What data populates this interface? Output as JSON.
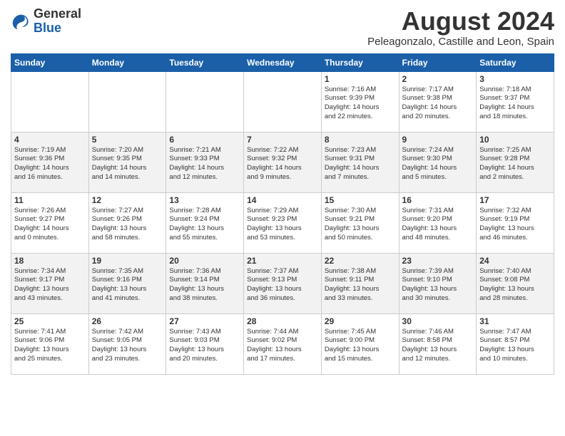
{
  "header": {
    "logo_general": "General",
    "logo_blue": "Blue",
    "month_title": "August 2024",
    "subtitle": "Peleagonzalo, Castille and Leon, Spain"
  },
  "days_of_week": [
    "Sunday",
    "Monday",
    "Tuesday",
    "Wednesday",
    "Thursday",
    "Friday",
    "Saturday"
  ],
  "weeks": [
    [
      {
        "day": "",
        "info": ""
      },
      {
        "day": "",
        "info": ""
      },
      {
        "day": "",
        "info": ""
      },
      {
        "day": "",
        "info": ""
      },
      {
        "day": "1",
        "info": "Sunrise: 7:16 AM\nSunset: 9:39 PM\nDaylight: 14 hours\nand 22 minutes."
      },
      {
        "day": "2",
        "info": "Sunrise: 7:17 AM\nSunset: 9:38 PM\nDaylight: 14 hours\nand 20 minutes."
      },
      {
        "day": "3",
        "info": "Sunrise: 7:18 AM\nSunset: 9:37 PM\nDaylight: 14 hours\nand 18 minutes."
      }
    ],
    [
      {
        "day": "4",
        "info": "Sunrise: 7:19 AM\nSunset: 9:36 PM\nDaylight: 14 hours\nand 16 minutes."
      },
      {
        "day": "5",
        "info": "Sunrise: 7:20 AM\nSunset: 9:35 PM\nDaylight: 14 hours\nand 14 minutes."
      },
      {
        "day": "6",
        "info": "Sunrise: 7:21 AM\nSunset: 9:33 PM\nDaylight: 14 hours\nand 12 minutes."
      },
      {
        "day": "7",
        "info": "Sunrise: 7:22 AM\nSunset: 9:32 PM\nDaylight: 14 hours\nand 9 minutes."
      },
      {
        "day": "8",
        "info": "Sunrise: 7:23 AM\nSunset: 9:31 PM\nDaylight: 14 hours\nand 7 minutes."
      },
      {
        "day": "9",
        "info": "Sunrise: 7:24 AM\nSunset: 9:30 PM\nDaylight: 14 hours\nand 5 minutes."
      },
      {
        "day": "10",
        "info": "Sunrise: 7:25 AM\nSunset: 9:28 PM\nDaylight: 14 hours\nand 2 minutes."
      }
    ],
    [
      {
        "day": "11",
        "info": "Sunrise: 7:26 AM\nSunset: 9:27 PM\nDaylight: 14 hours\nand 0 minutes."
      },
      {
        "day": "12",
        "info": "Sunrise: 7:27 AM\nSunset: 9:26 PM\nDaylight: 13 hours\nand 58 minutes."
      },
      {
        "day": "13",
        "info": "Sunrise: 7:28 AM\nSunset: 9:24 PM\nDaylight: 13 hours\nand 55 minutes."
      },
      {
        "day": "14",
        "info": "Sunrise: 7:29 AM\nSunset: 9:23 PM\nDaylight: 13 hours\nand 53 minutes."
      },
      {
        "day": "15",
        "info": "Sunrise: 7:30 AM\nSunset: 9:21 PM\nDaylight: 13 hours\nand 50 minutes."
      },
      {
        "day": "16",
        "info": "Sunrise: 7:31 AM\nSunset: 9:20 PM\nDaylight: 13 hours\nand 48 minutes."
      },
      {
        "day": "17",
        "info": "Sunrise: 7:32 AM\nSunset: 9:19 PM\nDaylight: 13 hours\nand 46 minutes."
      }
    ],
    [
      {
        "day": "18",
        "info": "Sunrise: 7:34 AM\nSunset: 9:17 PM\nDaylight: 13 hours\nand 43 minutes."
      },
      {
        "day": "19",
        "info": "Sunrise: 7:35 AM\nSunset: 9:16 PM\nDaylight: 13 hours\nand 41 minutes."
      },
      {
        "day": "20",
        "info": "Sunrise: 7:36 AM\nSunset: 9:14 PM\nDaylight: 13 hours\nand 38 minutes."
      },
      {
        "day": "21",
        "info": "Sunrise: 7:37 AM\nSunset: 9:13 PM\nDaylight: 13 hours\nand 36 minutes."
      },
      {
        "day": "22",
        "info": "Sunrise: 7:38 AM\nSunset: 9:11 PM\nDaylight: 13 hours\nand 33 minutes."
      },
      {
        "day": "23",
        "info": "Sunrise: 7:39 AM\nSunset: 9:10 PM\nDaylight: 13 hours\nand 30 minutes."
      },
      {
        "day": "24",
        "info": "Sunrise: 7:40 AM\nSunset: 9:08 PM\nDaylight: 13 hours\nand 28 minutes."
      }
    ],
    [
      {
        "day": "25",
        "info": "Sunrise: 7:41 AM\nSunset: 9:06 PM\nDaylight: 13 hours\nand 25 minutes."
      },
      {
        "day": "26",
        "info": "Sunrise: 7:42 AM\nSunset: 9:05 PM\nDaylight: 13 hours\nand 23 minutes."
      },
      {
        "day": "27",
        "info": "Sunrise: 7:43 AM\nSunset: 9:03 PM\nDaylight: 13 hours\nand 20 minutes."
      },
      {
        "day": "28",
        "info": "Sunrise: 7:44 AM\nSunset: 9:02 PM\nDaylight: 13 hours\nand 17 minutes."
      },
      {
        "day": "29",
        "info": "Sunrise: 7:45 AM\nSunset: 9:00 PM\nDaylight: 13 hours\nand 15 minutes."
      },
      {
        "day": "30",
        "info": "Sunrise: 7:46 AM\nSunset: 8:58 PM\nDaylight: 13 hours\nand 12 minutes."
      },
      {
        "day": "31",
        "info": "Sunrise: 7:47 AM\nSunset: 8:57 PM\nDaylight: 13 hours\nand 10 minutes."
      }
    ]
  ]
}
